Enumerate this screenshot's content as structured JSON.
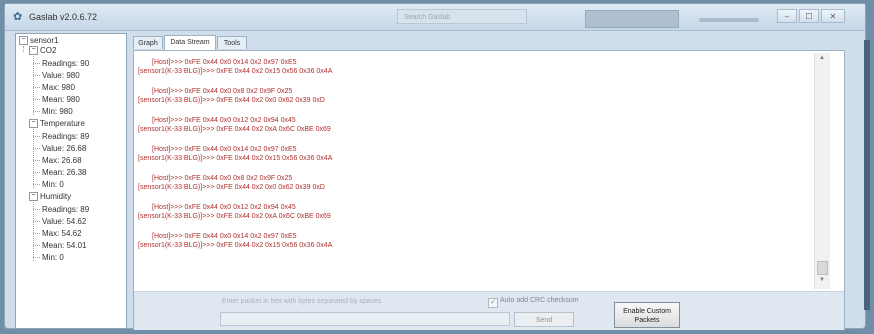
{
  "window": {
    "title": "Gaslab v2.0.6.72",
    "search_placeholder": "Search Gaslab",
    "controls": {
      "minimize": "–",
      "maximize": "☐",
      "close": "✕"
    }
  },
  "tree": {
    "root": "sensor1",
    "groups": [
      {
        "name": "CO2",
        "items": [
          "Readings: 90",
          "Value: 980",
          "Max: 980",
          "Mean: 980",
          "Min: 980"
        ]
      },
      {
        "name": "Temperature",
        "items": [
          "Readings: 89",
          "Value: 26.68",
          "Max: 26.68",
          "Mean: 26.38",
          "Min: 0"
        ]
      },
      {
        "name": "Humidity",
        "items": [
          "Readings: 89",
          "Value: 54.62",
          "Max: 54.62",
          "Mean: 54.01",
          "Min: 0"
        ]
      }
    ]
  },
  "tabs": [
    "Graph",
    "Data Stream",
    "Tools"
  ],
  "active_tab": "Data Stream",
  "stream": [
    {
      "host": "[Host]>>> 0xFE 0x44 0x0 0x14 0x2 0x97 0xE5",
      "sensor": "[sensor1(K-33 BLG)]>>> 0xFE 0x44 0x2 0x15 0x56 0x36 0x4A"
    },
    {
      "host": "[Host]>>> 0xFE 0x44 0x0 0x8 0x2 0x9F 0x25",
      "sensor": "[sensor1(K-33 BLG)]>>> 0xFE 0x44 0x2 0x0 0x62 0x39 0xD"
    },
    {
      "host": "[Host]>>> 0xFE 0x44 0x0 0x12 0x2 0x94 0x45",
      "sensor": "[sensor1(K-33 BLG)]>>> 0xFE 0x44 0x2 0xA 0x6C 0xBE 0x69"
    },
    {
      "host": "[Host]>>> 0xFE 0x44 0x0 0x14 0x2 0x97 0xE5",
      "sensor": "[sensor1(K-33 BLG)]>>> 0xFE 0x44 0x2 0x15 0x56 0x36 0x4A"
    },
    {
      "host": "[Host]>>> 0xFE 0x44 0x0 0x8 0x2 0x9F 0x25",
      "sensor": "[sensor1(K-33 BLG)]>>> 0xFE 0x44 0x2 0x0 0x62 0x39 0xD"
    },
    {
      "host": "[Host]>>> 0xFE 0x44 0x0 0x12 0x2 0x94 0x45",
      "sensor": "[sensor1(K-33 BLG)]>>> 0xFE 0x44 0x2 0xA 0x6C 0xBE 0x69"
    },
    {
      "host": "[Host]>>> 0xFE 0x44 0x0 0x14 0x2 0x97 0xE5",
      "sensor": "[sensor1(K-33 BLG)]>>> 0xFE 0x44 0x2 0x15 0x56 0x36 0x4A"
    }
  ],
  "bottom": {
    "packet_placeholder": "Enter packet in hex with bytes separated by spaces",
    "crc_label": "Auto add CRC checksum",
    "crc_checked": true,
    "send_label": "Send",
    "custom_label": [
      "Enable Custom",
      "Packets"
    ]
  },
  "colors": {
    "stream_text": "#b03030",
    "window_bg": "#cfdeea",
    "desktop": "#6f8fa8"
  }
}
